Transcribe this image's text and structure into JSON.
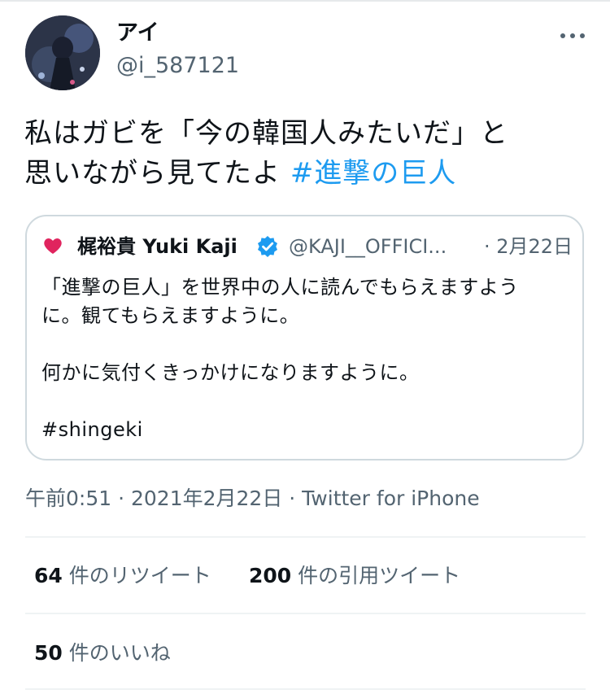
{
  "user": {
    "display_name": "アイ",
    "handle": "@i_587121"
  },
  "tweet": {
    "text_line1": "私はガビを「今の韓国人みたいだ」と",
    "text_line2": "思いながら見てたよ ",
    "hashtag": "#進撃の巨人"
  },
  "quoted": {
    "display_name": "梶裕貴 Yuki Kaji",
    "handle": "@KAJI__OFFICI...",
    "date": "· 2月22日",
    "body_line1": "「進撃の巨人」を世界中の人に読んでもらえますよう",
    "body_line2": "に。観てもらえますように。",
    "body_line3": "何かに気付くきっかけになりますように。",
    "body_hashtag": "#shingeki"
  },
  "meta": {
    "timestamp": "午前0:51 · 2021年2月22日 · ",
    "source": "Twitter for iPhone"
  },
  "stats": {
    "retweets_count": "64",
    "retweets_label": "件のリツイート",
    "quotes_count": "200",
    "quotes_label": "件の引用ツイート",
    "likes_count": "50",
    "likes_label": "件のいいね"
  },
  "colors": {
    "link": "#1d9bf0",
    "secondary_text": "#536471",
    "verified": "#1d9bf0",
    "heart": "#e0245e"
  },
  "icons": [
    "more-icon",
    "heart-icon",
    "verified-badge-icon"
  ]
}
